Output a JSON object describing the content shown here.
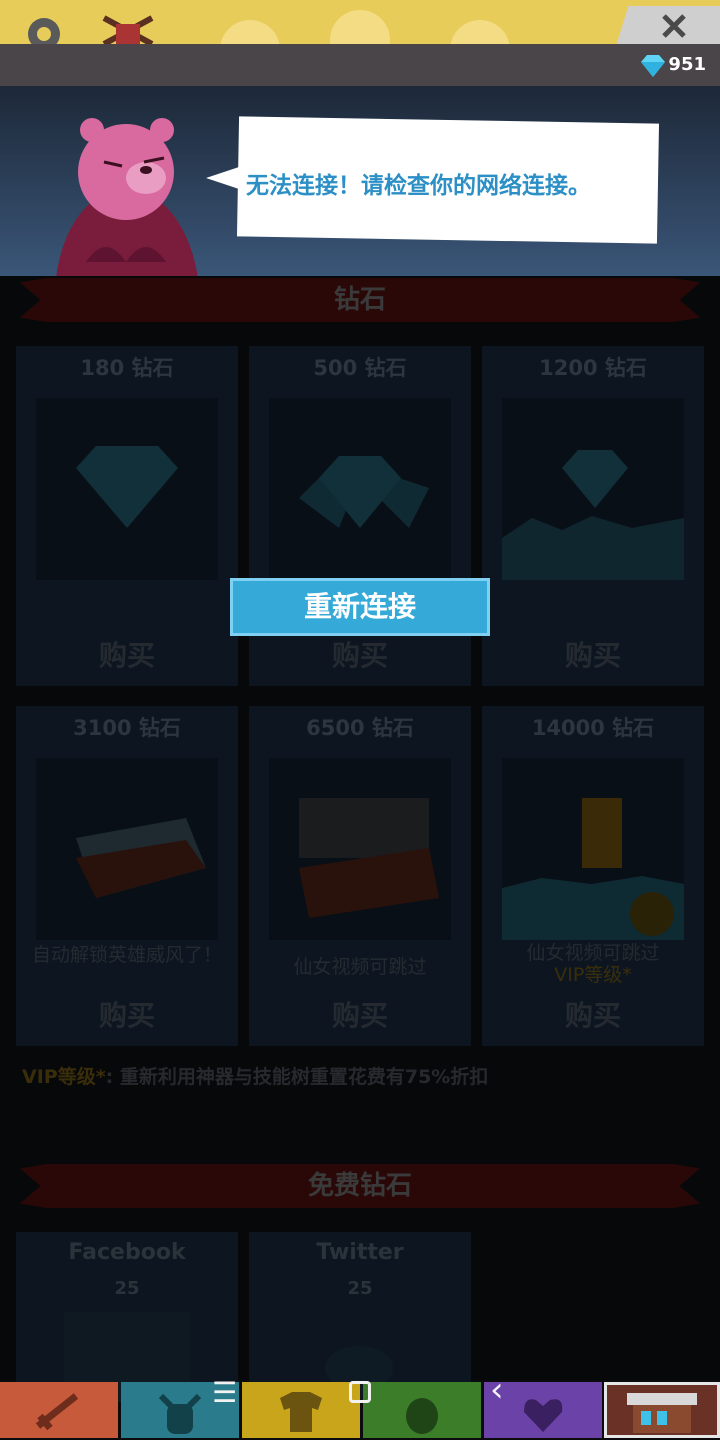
{
  "top_bar": {
    "gem_count": "951"
  },
  "dialog": {
    "message": "无法连接！请检查你的网络连接。"
  },
  "reconnect_button": {
    "label": "重新连接"
  },
  "diamond_section": {
    "title": "钻石",
    "cards": [
      {
        "title": "180 钻石",
        "buy": "购买",
        "desc": "",
        "desc_vip": ""
      },
      {
        "title": "500 钻石",
        "buy": "购买",
        "desc": "",
        "desc_vip": ""
      },
      {
        "title": "1200 钻石",
        "buy": "购买",
        "desc": "",
        "desc_vip": ""
      },
      {
        "title": "3100 钻石",
        "buy": "购买",
        "desc": "自动解锁英雄威风了！",
        "desc_vip": ""
      },
      {
        "title": "6500 钻石",
        "buy": "购买",
        "desc": "仙女视频可跳过",
        "desc_vip": ""
      },
      {
        "title": "14000 钻石",
        "buy": "购买",
        "desc": "仙女视频可跳过",
        "desc_vip": "VIP等级*"
      }
    ],
    "vip_badge": "VIP",
    "vip_note_label": "VIP等级*",
    "vip_note_text": ": 重新利用神器与技能树重置花费有75%折扣"
  },
  "free_section": {
    "title": "免费钻石",
    "cards": [
      {
        "title": "Facebook",
        "reward": "25"
      },
      {
        "title": "Twitter",
        "reward": "25"
      }
    ]
  },
  "bottom_nav": {
    "tabs": [
      {
        "name": "sword",
        "color": "#c75a3a"
      },
      {
        "name": "viking",
        "color": "#2a7b8c"
      },
      {
        "name": "shirt",
        "color": "#c9a51c"
      },
      {
        "name": "demon",
        "color": "#3c7d2a"
      },
      {
        "name": "heart",
        "color": "#6a42a8"
      },
      {
        "name": "shop",
        "color": "#6a3226"
      }
    ]
  },
  "system_nav": {
    "menu_icon": "☰",
    "home_icon": "▢",
    "back_icon": "‹"
  }
}
